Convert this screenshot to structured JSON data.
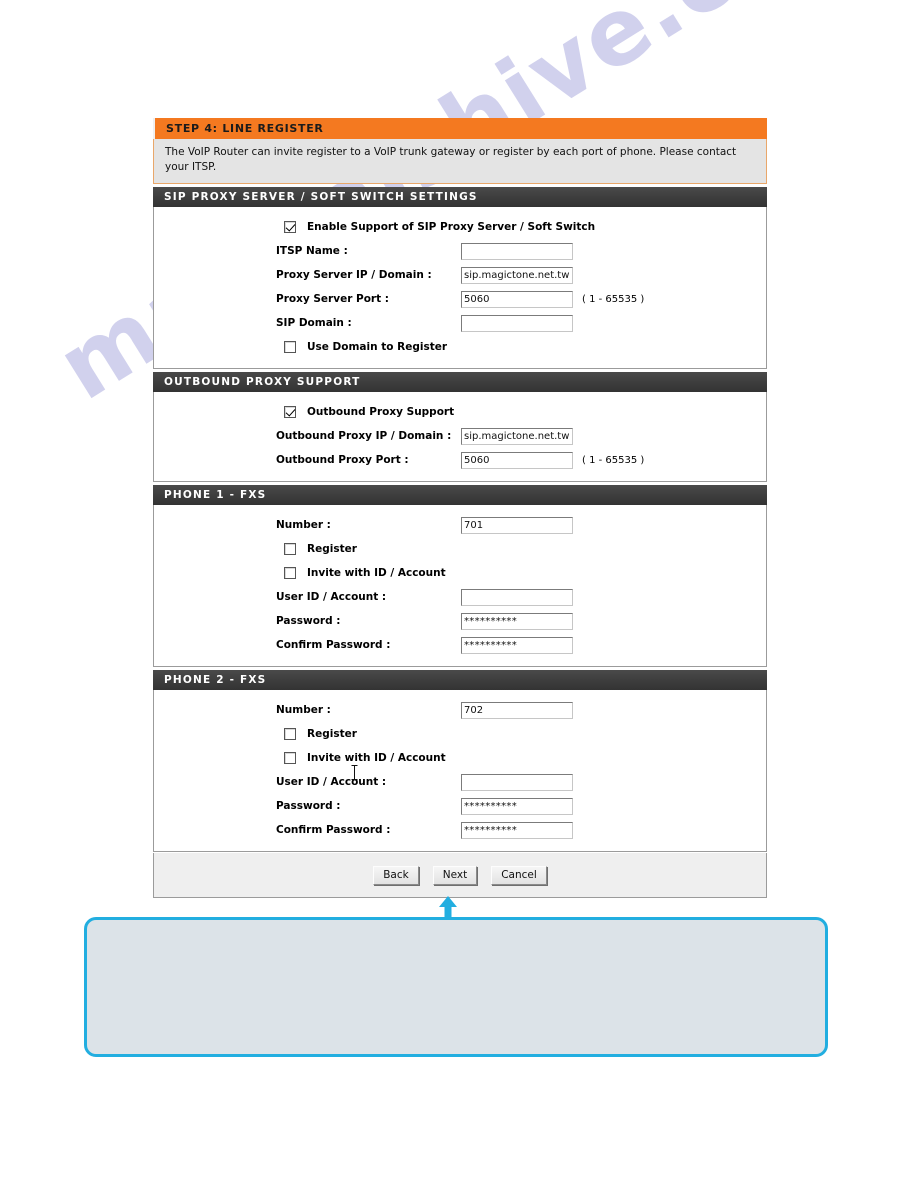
{
  "watermark": {
    "text": "manualshive.com"
  },
  "step": {
    "title": "STEP 4: LINE REGISTER",
    "description": "The VoIP Router can invite register to a VoIP trunk gateway or register by each port of phone. Please contact your ITSP."
  },
  "sections": [
    {
      "id": "sip-proxy",
      "title": "SIP PROXY SERVER / SOFT SWITCH SETTINGS",
      "rows": [
        {
          "type": "checkbox",
          "label": "Enable Support of SIP Proxy Server / Soft Switch",
          "checked": true
        },
        {
          "type": "field",
          "label": "ITSP Name :",
          "value": "",
          "hint": ""
        },
        {
          "type": "field",
          "label": "Proxy Server IP / Domain :",
          "value": "sip.magictone.net.tw",
          "hint": ""
        },
        {
          "type": "field",
          "label": "Proxy Server Port :",
          "value": "5060",
          "hint": "( 1 - 65535 )"
        },
        {
          "type": "field",
          "label": "SIP Domain :",
          "value": "",
          "hint": ""
        },
        {
          "type": "checkbox",
          "label": "Use Domain to Register",
          "checked": false
        }
      ]
    },
    {
      "id": "outbound-proxy",
      "title": "OUTBOUND PROXY SUPPORT",
      "rows": [
        {
          "type": "checkbox",
          "label": "Outbound Proxy Support",
          "checked": true
        },
        {
          "type": "field",
          "label": "Outbound Proxy IP / Domain :",
          "value": "sip.magictone.net.tw",
          "hint": ""
        },
        {
          "type": "field",
          "label": "Outbound Proxy Port :",
          "value": "5060",
          "hint": "( 1 - 65535 )"
        }
      ]
    },
    {
      "id": "phone-1-fxs",
      "title": "PHONE 1 - FXS",
      "rows": [
        {
          "type": "field",
          "label": "Number :",
          "value": "701",
          "hint": ""
        },
        {
          "type": "checkbox",
          "label": "Register",
          "checked": false
        },
        {
          "type": "checkbox",
          "label": "Invite with ID / Account",
          "checked": false
        },
        {
          "type": "field",
          "label": "User ID / Account :",
          "value": "",
          "hint": ""
        },
        {
          "type": "password",
          "label": "Password :",
          "value": "**********",
          "hint": ""
        },
        {
          "type": "password",
          "label": "Confirm Password :",
          "value": "**********",
          "hint": ""
        }
      ]
    },
    {
      "id": "phone-2-fxs",
      "title": "PHONE 2 - FXS",
      "rows": [
        {
          "type": "field",
          "label": "Number :",
          "value": "702",
          "hint": ""
        },
        {
          "type": "checkbox",
          "label": "Register",
          "checked": false
        },
        {
          "type": "checkbox",
          "label": "Invite with ID / Account",
          "checked": false
        },
        {
          "type": "field",
          "label": "User ID / Account :",
          "value": "",
          "hint": ""
        },
        {
          "type": "password",
          "label": "Password :",
          "value": "**********",
          "hint": ""
        },
        {
          "type": "password",
          "label": "Confirm Password :",
          "value": "**********",
          "hint": ""
        }
      ]
    }
  ],
  "footer": {
    "buttons": [
      {
        "id": "back",
        "label": "Back"
      },
      {
        "id": "next",
        "label": "Next"
      },
      {
        "id": "cancel",
        "label": "Cancel"
      }
    ]
  },
  "colors": {
    "step_bar": "#f47920",
    "section_header": "#3e3e3e",
    "callout_border": "#22aee0",
    "callout_fill": "#dce3e8",
    "cursor_arrow": "#22aee0",
    "watermark": "#c9c9ea"
  },
  "callout": {
    "text": ""
  }
}
